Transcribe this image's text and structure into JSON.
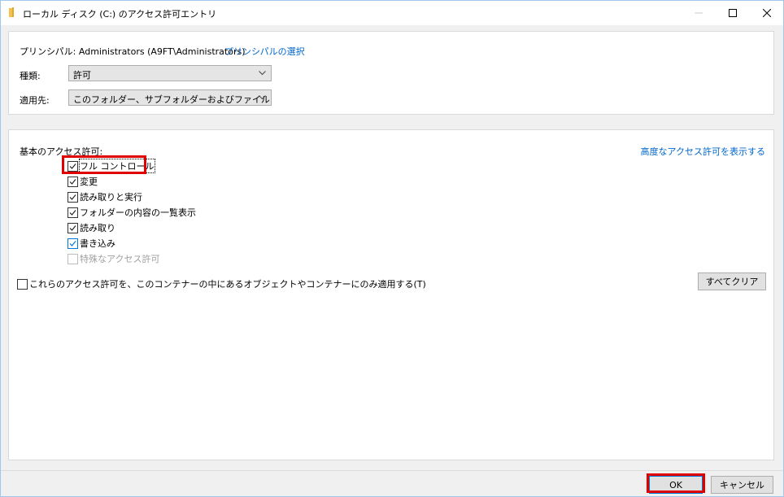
{
  "window": {
    "title": "ローカル ディスク (C:) のアクセス許可エントリ"
  },
  "principal": {
    "label": "プリンシパル:",
    "value": "Administrators (A9FT\\Administrators)",
    "select_link": "プリンシパルの選択"
  },
  "type": {
    "label": "種類:",
    "value": "許可"
  },
  "applies_to": {
    "label": "適用先:",
    "value": "このフォルダー、サブフォルダーおよびファイル"
  },
  "permissions": {
    "header": "基本のアクセス許可:",
    "advanced_link": "高度なアクセス許可を表示する",
    "items": [
      {
        "label": "フル コントロール",
        "checked": true,
        "disabled": false
      },
      {
        "label": "変更",
        "checked": true,
        "disabled": false
      },
      {
        "label": "読み取りと実行",
        "checked": true,
        "disabled": false
      },
      {
        "label": "フォルダーの内容の一覧表示",
        "checked": true,
        "disabled": false
      },
      {
        "label": "読み取り",
        "checked": true,
        "disabled": false
      },
      {
        "label": "書き込み",
        "checked": true,
        "disabled": false
      },
      {
        "label": "特殊なアクセス許可",
        "checked": false,
        "disabled": true
      }
    ],
    "apply_only_container": "これらのアクセス許可を、このコンテナーの中にあるオブジェクトやコンテナーにのみ適用する(T)",
    "clear_all": "すべてクリア"
  },
  "footer": {
    "ok": "OK",
    "cancel": "キャンセル"
  },
  "colors": {
    "highlight": "#e00000",
    "link": "#0066cc",
    "folder_icon": "#f2c14e"
  }
}
